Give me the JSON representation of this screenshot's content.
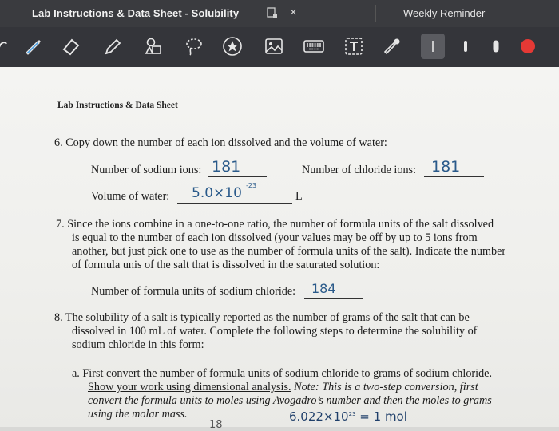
{
  "tabs": {
    "active_title": "Lab Instructions & Data Sheet - Solubility",
    "close_glyph": "×",
    "other_title": "Weekly Reminder"
  },
  "toolbar": {
    "tools": [
      "pen-icon",
      "eraser-icon",
      "highlighter-icon",
      "shapes-icon",
      "lasso-icon",
      "star-sticker-icon",
      "image-icon",
      "keyboard-icon",
      "text-box-icon",
      "eyedropper-icon",
      "thin-stroke-icon",
      "medium-stroke-icon",
      "thick-stroke-icon",
      "red-color-icon"
    ],
    "accent_color": "#e53935",
    "pen_color": "#4ea3e6"
  },
  "document": {
    "header": "Lab Instructions & Data Sheet",
    "q6": {
      "prompt": "6. Copy down the number of each ion dissolved and the volume of water:",
      "sodium_label": "Number of sodium ions:",
      "sodium_value": "181",
      "chloride_label": "Number of chloride ions:",
      "chloride_value": "181",
      "volume_label": "Volume of water:",
      "volume_value": "5.0×10",
      "volume_exp": "-23",
      "volume_unit": "L"
    },
    "q7": {
      "lines": [
        "7. Since the ions combine in a one-to-one ratio, the number of formula units of the salt dissolved",
        "is equal to the number of each ion dissolved (your values may be off by up to 5 ions from",
        "another, but just pick one to use as the number of formula units of the salt). Indicate the number",
        "of formula unis of the salt that is dissolved in the saturated solution:"
      ],
      "formula_label": "Number of formula units of sodium chloride:",
      "formula_value": "184"
    },
    "q8": {
      "lines": [
        "8. The solubility of a salt is typically reported as the number of grams of the salt that can be",
        "dissolved in 100 mL of water. Complete the following steps to determine the solubility of",
        "sodium chloride in this form:"
      ]
    },
    "qa": {
      "line1": "a. First convert the number of formula units of sodium chloride to grams of sodium chloride.",
      "line2_underlined": "Show your work using dimensional analysis.",
      "line2_rest": " Note: This is a two-step conversion, first",
      "line3": "convert the formula units to moles using Avogadro’s number and then the moles to grams",
      "line4": "using the molar mass.",
      "hw_avogadro": "6.022×10",
      "hw_avogadro_exp": "23",
      "hw_avogadro_rest": " = 1 mol",
      "hw_partial": "18"
    }
  }
}
